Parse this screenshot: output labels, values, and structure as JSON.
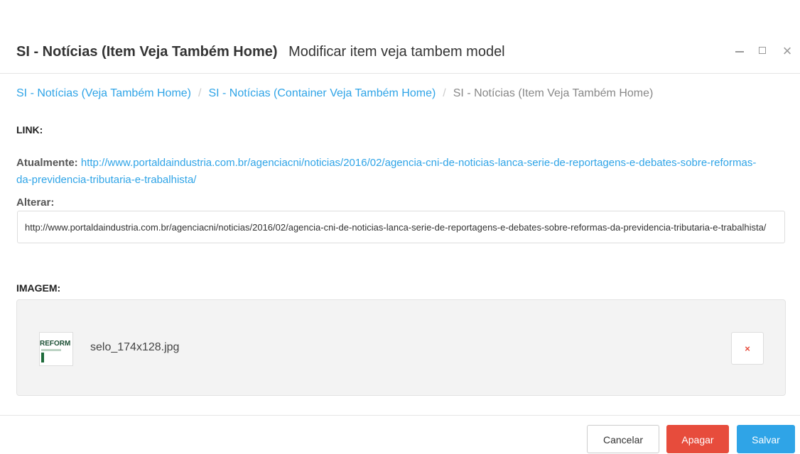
{
  "header": {
    "title": "SI - Notícias (Item Veja Também Home)",
    "subtitle": "Modificar item veja tambem model",
    "close_glyph": "×"
  },
  "breadcrumb": {
    "items": [
      "SI - Notícias (Veja Também Home)",
      "SI - Notícias (Container Veja Também Home)",
      "SI - Notícias (Item Veja Também Home)"
    ],
    "separator": "/"
  },
  "link_section": {
    "label": "LINK:",
    "current_label": "Atualmente:",
    "current_url": "http://www.portaldaindustria.com.br/agenciacni/noticias/2016/02/agencia-cni-de-noticias-lanca-serie-de-reportagens-e-debates-sobre-reformas-da-previdencia-tributaria-e-trabalhista/",
    "change_label": "Alterar:",
    "input_value": "http://www.portaldaindustria.com.br/agenciacni/noticias/2016/02/agencia-cni-de-noticias-lanca-serie-de-reportagens-e-debates-sobre-reformas-da-previdencia-tributaria-e-trabalhista/"
  },
  "image_section": {
    "label": "IMAGEM:",
    "thumbnail_text": "REFORM",
    "file_name": "selo_174x128.jpg",
    "remove_glyph": "×"
  },
  "footer": {
    "cancel_label": "Cancelar",
    "delete_label": "Apagar",
    "save_label": "Salvar"
  },
  "colors": {
    "link": "#2fa4e7",
    "danger": "#e74c3c",
    "primary": "#2fa4e7"
  },
  "icons": [
    "minimize-icon",
    "maximize-icon",
    "close-icon",
    "remove-icon"
  ]
}
